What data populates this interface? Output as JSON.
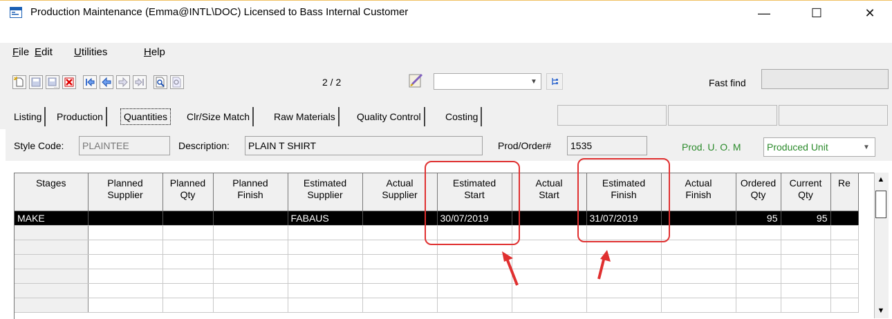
{
  "window": {
    "title": "Production Maintenance (Emma@INTL\\DOC) Licensed to Bass Internal Customer",
    "minimize_glyph": "—",
    "maximize_glyph": "☐",
    "close_glyph": "✕"
  },
  "menu": {
    "file": "ile",
    "file_key": "F",
    "edit": "dit",
    "edit_key": "E",
    "utilities": "tilities",
    "utilities_key": "U",
    "help": "elp",
    "help_key": "H"
  },
  "toolbar": {
    "page_count": "2 / 2",
    "fast_find_label": "Fast find",
    "combo_value": ""
  },
  "tabs": [
    "Listing",
    "Production",
    "Quantities",
    "Clr/Size Match",
    "Raw Materials",
    "Quality Control",
    "Costing"
  ],
  "form": {
    "style_code_label": "Style Code:",
    "style_code_value": "PLAINTEE",
    "description_label": "Description:",
    "description_value": "PLAIN T SHIRT",
    "prod_order_label": "Prod/Order#",
    "prod_order_value": "1535",
    "uom_label": "Prod. U. O. M",
    "uom_value": "Produced Unit"
  },
  "grid": {
    "headers": [
      [
        "Stages",
        ""
      ],
      [
        "Planned",
        "Supplier"
      ],
      [
        "Planned",
        "Qty"
      ],
      [
        "Planned",
        "Finish"
      ],
      [
        "Estimated",
        "Supplier"
      ],
      [
        "Actual",
        "Supplier"
      ],
      [
        "Estimated",
        "Start"
      ],
      [
        "Actual",
        "Start"
      ],
      [
        "Estimated",
        "Finish"
      ],
      [
        "Actual",
        "Finish"
      ],
      [
        "Ordered",
        "Qty"
      ],
      [
        "Current",
        "Qty"
      ],
      [
        "Re",
        ""
      ]
    ],
    "rows": [
      [
        "MAKE",
        "",
        "",
        "",
        "FABAUS",
        "",
        "30/07/2019",
        "",
        "31/07/2019",
        "",
        "95",
        "95",
        ""
      ]
    ]
  },
  "colors": {
    "highlight": "#e03030",
    "uom_text": "#2a8a2a",
    "selected_row_bg": "#000000"
  }
}
